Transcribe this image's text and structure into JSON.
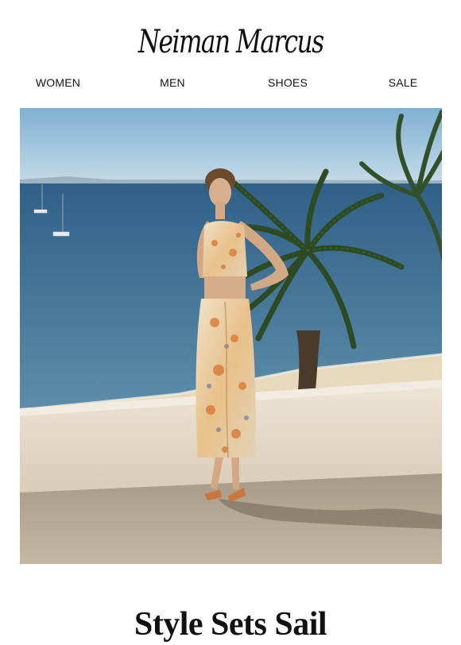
{
  "brand": {
    "logo_text": "Neiman Marcus"
  },
  "nav": {
    "items": [
      {
        "label": "WOMEN"
      },
      {
        "label": "MEN"
      },
      {
        "label": "SHOES"
      },
      {
        "label": "SALE"
      }
    ]
  },
  "hero": {
    "image_icon": "hero-photo",
    "colors": {
      "sky": "#8fb8d6",
      "sea": "#3e6f93",
      "wall": "#e6dccd",
      "gravel": "#b5a895",
      "palm": "#2f4a23"
    }
  },
  "headline": {
    "text": "Style Sets Sail"
  }
}
